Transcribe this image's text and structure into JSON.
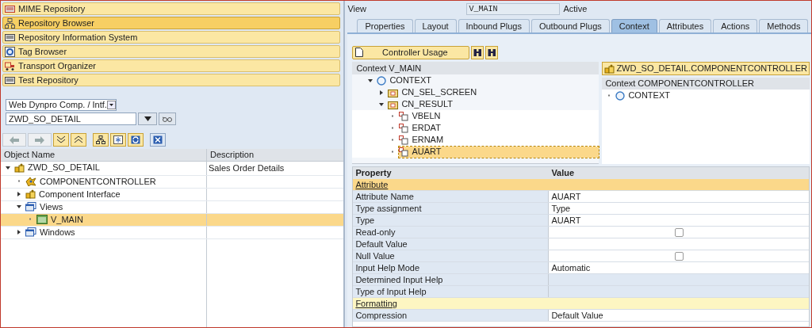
{
  "nav_buttons": [
    {
      "label": "MIME Repository",
      "selected": false,
      "kind": "mime"
    },
    {
      "label": "Repository Browser",
      "selected": true,
      "kind": "browser"
    },
    {
      "label": "Repository Information System",
      "selected": false,
      "kind": "info"
    },
    {
      "label": "Tag Browser",
      "selected": false,
      "kind": "tag"
    },
    {
      "label": "Transport Organizer",
      "selected": false,
      "kind": "transport"
    },
    {
      "label": "Test Repository",
      "selected": false,
      "kind": "test"
    }
  ],
  "object_type_select": {
    "value": "Web Dynpro Comp. / Intf."
  },
  "object_name_field": {
    "value": "ZWD_SO_DETAIL"
  },
  "object_tree": {
    "columns": [
      "Object Name",
      "Description"
    ],
    "nodes": [
      {
        "label": "ZWD_SO_DETAIL",
        "description": "Sales Order Details",
        "kind": "component",
        "expanded": true,
        "selected": false,
        "children": [
          {
            "label": "COMPONENTCONTROLLER",
            "kind": "controller",
            "selected": false
          },
          {
            "label": "Component Interface",
            "kind": "component",
            "expanded": false,
            "selected": false
          },
          {
            "label": "Views",
            "kind": "window",
            "expanded": true,
            "selected": false,
            "children": [
              {
                "label": "V_MAIN",
                "kind": "view",
                "selected": true
              }
            ]
          },
          {
            "label": "Windows",
            "kind": "window",
            "expanded": false,
            "selected": false
          }
        ]
      }
    ]
  },
  "view": {
    "label": "View",
    "name": "V_MAIN",
    "status": "Active"
  },
  "tabs": [
    {
      "label": "Properties",
      "selected": false
    },
    {
      "label": "Layout",
      "selected": false
    },
    {
      "label": "Inbound Plugs",
      "selected": false
    },
    {
      "label": "Outbound Plugs",
      "selected": false
    },
    {
      "label": "Context",
      "selected": true
    },
    {
      "label": "Attributes",
      "selected": false
    },
    {
      "label": "Actions",
      "selected": false
    },
    {
      "label": "Methods",
      "selected": false
    }
  ],
  "controller_usage_button": "Controller Usage",
  "view_context": {
    "header": "Context V_MAIN",
    "nodes": [
      {
        "label": "CONTEXT",
        "kind": "root",
        "expanded": true,
        "selected": false,
        "children": [
          {
            "label": "CN_SEL_SCREEN",
            "kind": "node",
            "expanded": false,
            "selected": false
          },
          {
            "label": "CN_RESULT",
            "kind": "node",
            "expanded": true,
            "selected": false,
            "children": [
              {
                "label": "VBELN",
                "kind": "attribute",
                "selected": false
              },
              {
                "label": "ERDAT",
                "kind": "attribute",
                "selected": false
              },
              {
                "label": "ERNAM",
                "kind": "attribute",
                "selected": false
              },
              {
                "label": "AUART",
                "kind": "attribute",
                "selected": true
              }
            ]
          }
        ]
      }
    ]
  },
  "component_context": {
    "title": "ZWD_SO_DETAIL.COMPONENTCONTROLLER",
    "header": "Context COMPONENTCONTROLLER",
    "nodes": [
      {
        "label": "CONTEXT",
        "kind": "root",
        "selected": false
      }
    ]
  },
  "properties": {
    "columns": [
      "Property",
      "Value"
    ],
    "rows": [
      {
        "kind": "section",
        "label": "Attribute",
        "selected": true
      },
      {
        "kind": "text",
        "label": "Attribute Name",
        "value": "AUART",
        "editable": true
      },
      {
        "kind": "text",
        "label": "Type assignment",
        "value": "Type",
        "editable": true
      },
      {
        "kind": "text",
        "label": "Type",
        "value": "AUART",
        "editable": true
      },
      {
        "kind": "checkbox",
        "label": "Read-only",
        "checked": false
      },
      {
        "kind": "text",
        "label": "Default Value",
        "editable": true
      },
      {
        "kind": "checkbox",
        "label": "Null Value",
        "checked": false
      },
      {
        "kind": "text",
        "label": "Input Help Mode",
        "value": "Automatic",
        "editable": true
      },
      {
        "kind": "text",
        "label": "Determined Input Help",
        "editable": false
      },
      {
        "kind": "text",
        "label": "Type of Input Help",
        "editable": false
      },
      {
        "kind": "section",
        "label": "Formatting",
        "selected": false
      },
      {
        "kind": "text",
        "label": "Compression",
        "value": "Default Value",
        "editable": true
      }
    ]
  }
}
